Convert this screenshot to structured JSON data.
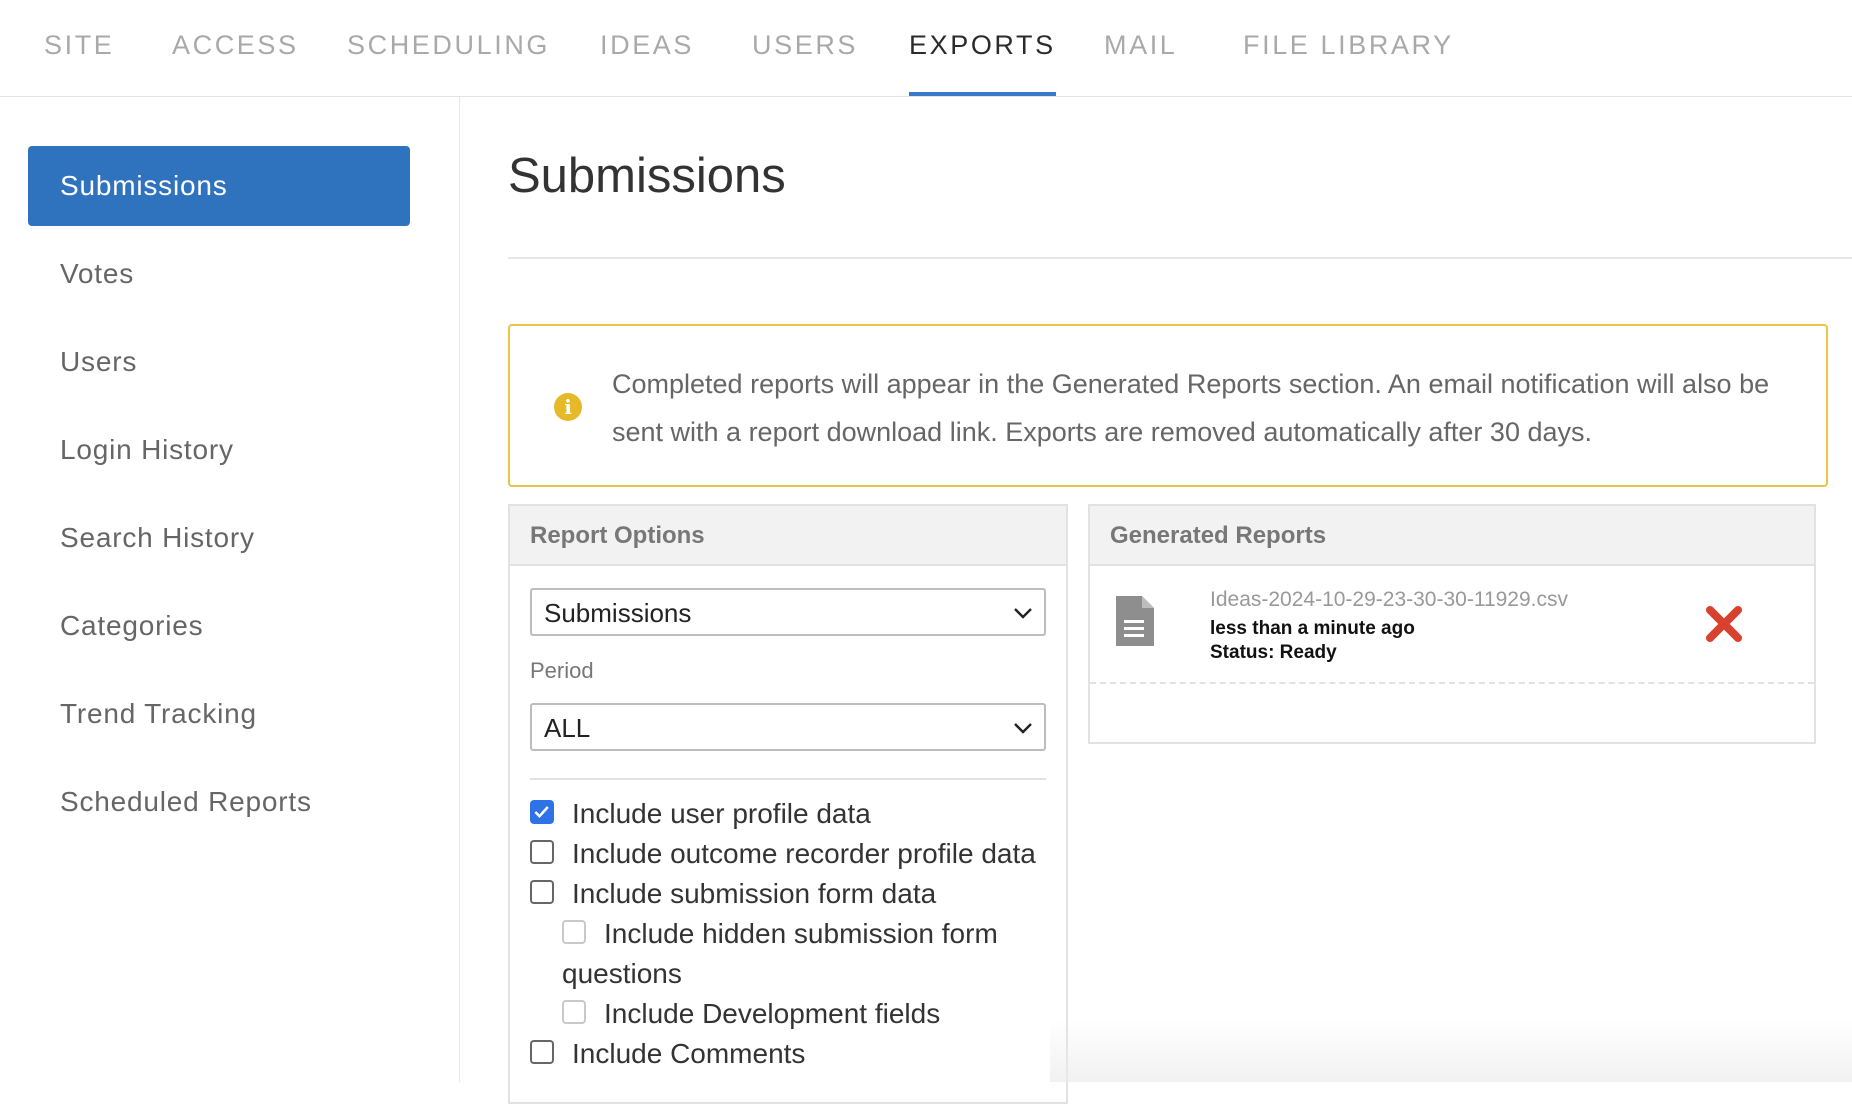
{
  "topnav": {
    "tabs": [
      {
        "label": "SITE"
      },
      {
        "label": "ACCESS"
      },
      {
        "label": "SCHEDULING"
      },
      {
        "label": "IDEAS"
      },
      {
        "label": "USERS"
      },
      {
        "label": "EXPORTS",
        "active": true
      },
      {
        "label": "MAIL"
      },
      {
        "label": "FILE LIBRARY"
      }
    ]
  },
  "sidebar": {
    "items": [
      {
        "label": "Submissions",
        "active": true
      },
      {
        "label": "Votes"
      },
      {
        "label": "Users"
      },
      {
        "label": "Login History"
      },
      {
        "label": "Search History"
      },
      {
        "label": "Categories"
      },
      {
        "label": "Trend Tracking"
      },
      {
        "label": "Scheduled Reports"
      }
    ]
  },
  "main": {
    "title": "Submissions",
    "notice": {
      "icon": "info-icon",
      "text": "Completed reports will appear in the Generated Reports section. An email notification will also be sent with a report download link. Exports are removed automatically after 30 days."
    }
  },
  "report_options": {
    "heading": "Report Options",
    "report_select": {
      "value": "Submissions"
    },
    "period_label": "Period",
    "period_select": {
      "value": "ALL"
    },
    "checkboxes": [
      {
        "label": "Include user profile data",
        "checked": true
      },
      {
        "label": "Include outcome recorder profile data",
        "checked": false
      },
      {
        "label": "Include submission form data",
        "checked": false
      },
      {
        "label": "Include hidden submission form",
        "label_cont": "questions",
        "checked": false,
        "disabled": true
      },
      {
        "label": "Include Development fields",
        "checked": false,
        "disabled": true
      },
      {
        "label": "Include Comments",
        "checked": false
      }
    ]
  },
  "generated_reports": {
    "heading": "Generated Reports",
    "items": [
      {
        "filename": "Ideas-2024-10-29-23-30-30-11929.csv",
        "time": "less than a minute ago",
        "status": "Status: Ready",
        "icon": "file-icon",
        "delete_icon": "close-icon"
      }
    ]
  },
  "colors": {
    "accent": "#2f72bd",
    "tab_underline": "#3c78c8",
    "notice_border": "#e8c54a",
    "info_icon": "#e6b928",
    "delete": "#d9412f",
    "checkbox": "#2f72e8"
  }
}
